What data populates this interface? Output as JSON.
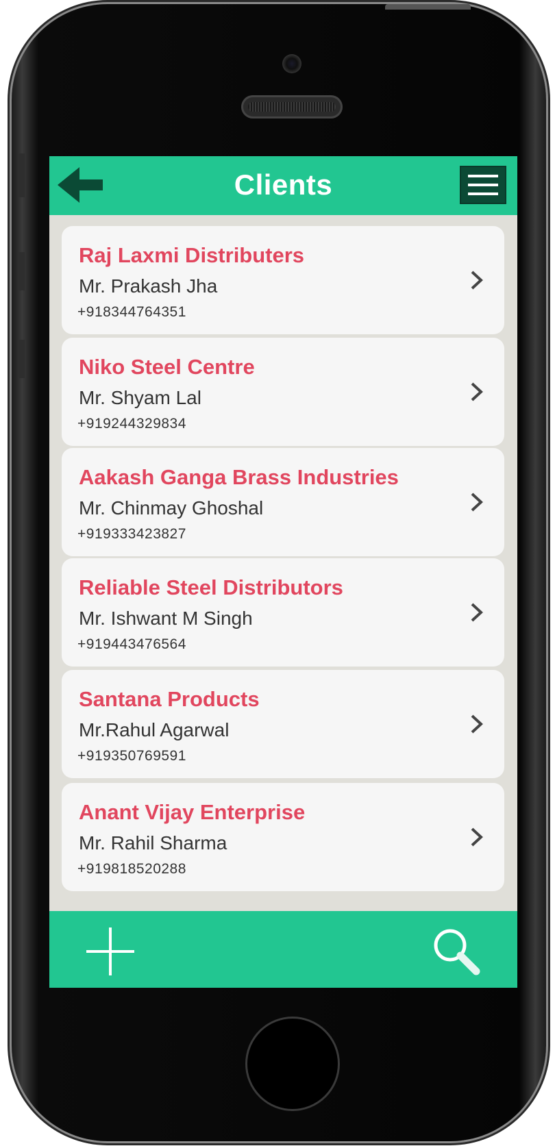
{
  "nav": {
    "title": "Clients",
    "back_icon": "back-arrow-icon",
    "menu_icon": "hamburger-menu-icon"
  },
  "clients": [
    {
      "company": "Raj Laxmi Distributers",
      "contact": "Mr. Prakash Jha",
      "phone": "+918344764351"
    },
    {
      "company": "Niko Steel Centre",
      "contact": "Mr. Shyam Lal",
      "phone": "+919244329834"
    },
    {
      "company": "Aakash Ganga Brass Industries",
      "contact": "Mr. Chinmay Ghoshal",
      "phone": "+919333423827"
    },
    {
      "company": "Reliable Steel Distributors",
      "contact": "Mr. Ishwant M Singh",
      "phone": "+919443476564"
    },
    {
      "company": "Santana Products",
      "contact": "Mr.Rahul Agarwal",
      "phone": "+919350769591"
    },
    {
      "company": "Anant Vijay Enterprise",
      "contact": "Mr. Rahil Sharma",
      "phone": "+919818520288"
    }
  ],
  "toolbar": {
    "add_icon": "plus-icon",
    "search_icon": "search-icon"
  },
  "colors": {
    "accent": "#22c691",
    "company_text": "#e1465e",
    "menu_bg": "#0b4a35",
    "list_bg": "#e0dfd9"
  }
}
